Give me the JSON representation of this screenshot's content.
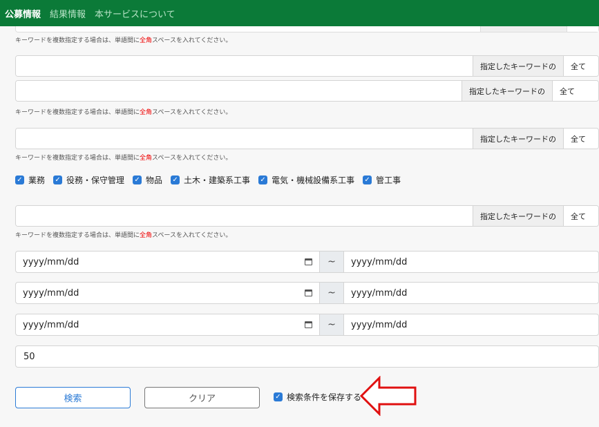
{
  "nav": {
    "items": [
      "公募情報",
      "結果情報",
      "本サービスについて"
    ]
  },
  "hint_prefix": "キーワードを複数指定する場合は、単語間に",
  "hint_red": "全角",
  "hint_suffix": "スペースを入れてください。",
  "keyword_rows": [
    {
      "label": "指定したキーワードの",
      "mode": "全て"
    },
    {
      "label": "指定したキーワードの",
      "mode": "全て"
    },
    {
      "label": "指定したキーワードの",
      "mode": "全て"
    },
    {
      "label": "指定したキーワードの",
      "mode": "全て"
    }
  ],
  "categories": [
    "業務",
    "役務・保守管理",
    "物品",
    "土木・建築系工事",
    "電気・機械設備系工事",
    "管工事"
  ],
  "date_ranges": [
    {
      "from": "yyyy/mm/dd",
      "sep": "~",
      "to": "yyyy/mm/dd"
    },
    {
      "from": "yyyy/mm/dd",
      "sep": "~",
      "to": "yyyy/mm/dd"
    },
    {
      "from": "yyyy/mm/dd",
      "sep": "~",
      "to": "yyyy/mm/dd"
    }
  ],
  "count_value": "50",
  "buttons": {
    "search": "検索",
    "clear": "クリア"
  },
  "save_label": "検索条件を保存する",
  "colors": {
    "nav": "#0b7a38",
    "accent": "#2a7ad6",
    "arrow": "#e01010"
  }
}
